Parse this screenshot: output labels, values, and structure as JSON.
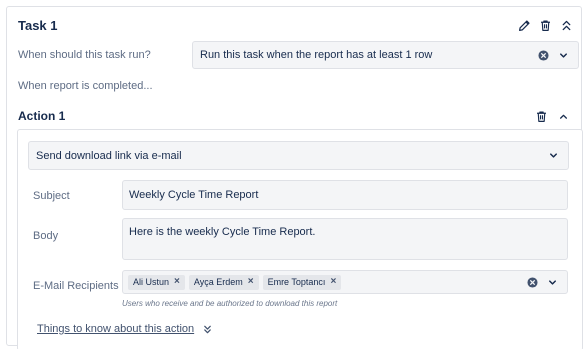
{
  "task": {
    "title": "Task 1",
    "icons": [
      "pencil-icon",
      "trash-icon",
      "collapse-icon"
    ],
    "run_label": "When should this task run?",
    "run_select_value": "Run this task when the report has at least 1 row",
    "completed_label": "When report is completed..."
  },
  "action": {
    "title": "Action 1",
    "icons": [
      "trash-icon",
      "chevron-up-icon"
    ],
    "method_select_value": "Send download link via e-mail",
    "subject_label": "Subject",
    "subject_value": "Weekly Cycle Time Report",
    "body_label": "Body",
    "body_value": "Here is the weekly Cycle Time Report.",
    "recipients_label": "E-Mail Recipients",
    "recipients": [
      "Ali Ustun",
      "Ayça Erdem",
      "Emre Toptancı"
    ],
    "recipients_helper": "Users who receive and be authorized to download this report",
    "things_link": "Things to know about this action"
  },
  "colors": {
    "border": "#dfe1e6",
    "field_bg": "#f4f5f7",
    "text": "#172b4d",
    "muted": "#5e6c84"
  }
}
